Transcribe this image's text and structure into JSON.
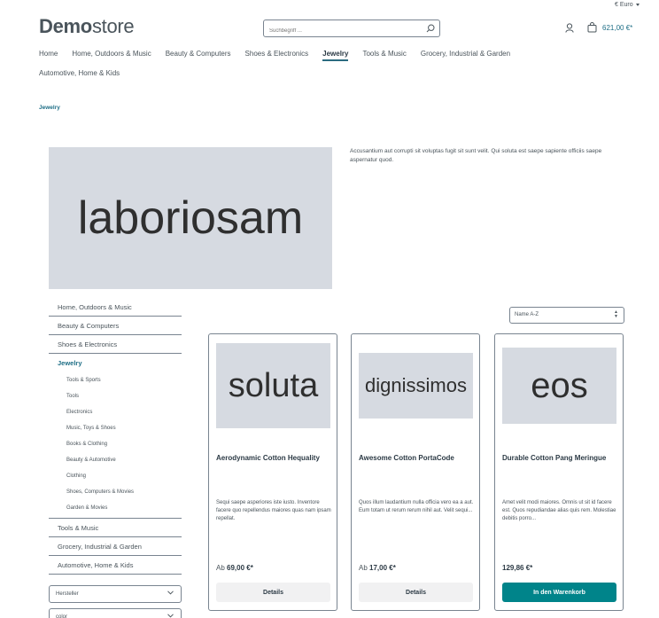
{
  "header": {
    "currency": "€ Euro",
    "logo_bold": "Demo",
    "logo_regular": "store",
    "search_placeholder": "Suchbegriff ...",
    "cart_total": "621,00 €*"
  },
  "mainnav": {
    "row1": [
      "Home",
      "Home, Outdoors & Music",
      "Beauty & Computers",
      "Shoes & Electronics",
      "Jewelry",
      "Tools & Music",
      "Grocery, Industrial & Garden"
    ],
    "row2": [
      "Automotive, Home & Kids"
    ],
    "active": "Jewelry"
  },
  "breadcrumb": "Jewelry",
  "hero": {
    "text": "laboriosam"
  },
  "description": "Accusantium aut corrupti sit voluptas fugit sit sunt velit. Qui soluta est saepe sapiente officiis saepe aspernatur quod.",
  "sidebar": {
    "before": [
      "Home, Outdoors & Music",
      "Beauty & Computers",
      "Shoes & Electronics"
    ],
    "active": "Jewelry",
    "children": [
      "Tools & Sports",
      "Tools",
      "Electronics",
      "Music, Toys & Shoes",
      "Books & Clothing",
      "Beauty & Automotive",
      "Clothing",
      "Shoes, Computers & Movies",
      "Garden & Movies"
    ],
    "after": [
      "Tools & Music",
      "Grocery, Industrial & Garden",
      "Automotive, Home & Kids"
    ]
  },
  "filters": [
    "Hersteller",
    "color"
  ],
  "sort": {
    "selected": "Name A-Z"
  },
  "products": [
    {
      "image_text": "soluta",
      "name": "Aerodynamic Cotton Hequality",
      "description": "Sequi saepe asperiores iste iusto. Inventore facere quo repellendus maiores quas nam ipsam repellat.",
      "price_prefix": "Ab",
      "price": "69,00 €*",
      "button": "Details",
      "button_style": "secondary"
    },
    {
      "image_text": "dignissimos",
      "name": "Awesome Cotton PortaCode",
      "description": "Quos illum laudantium nulla officia vero ea a aut. Eum totam ut rerum rerum nihil aut. Velit sequi...",
      "price_prefix": "Ab",
      "price": "17,00 €*",
      "button": "Details",
      "button_style": "secondary"
    },
    {
      "image_text": "eos",
      "name": "Durable Cotton Pang Meringue",
      "description": "Amet velit modi maiores. Omnis ut sit id facere est. Quos repudiandae alias quis rem. Molestiae debitis porro...",
      "price_prefix": "",
      "price": "129,86 €*",
      "button": "In den Warenkorb",
      "button_style": "primary"
    }
  ]
}
